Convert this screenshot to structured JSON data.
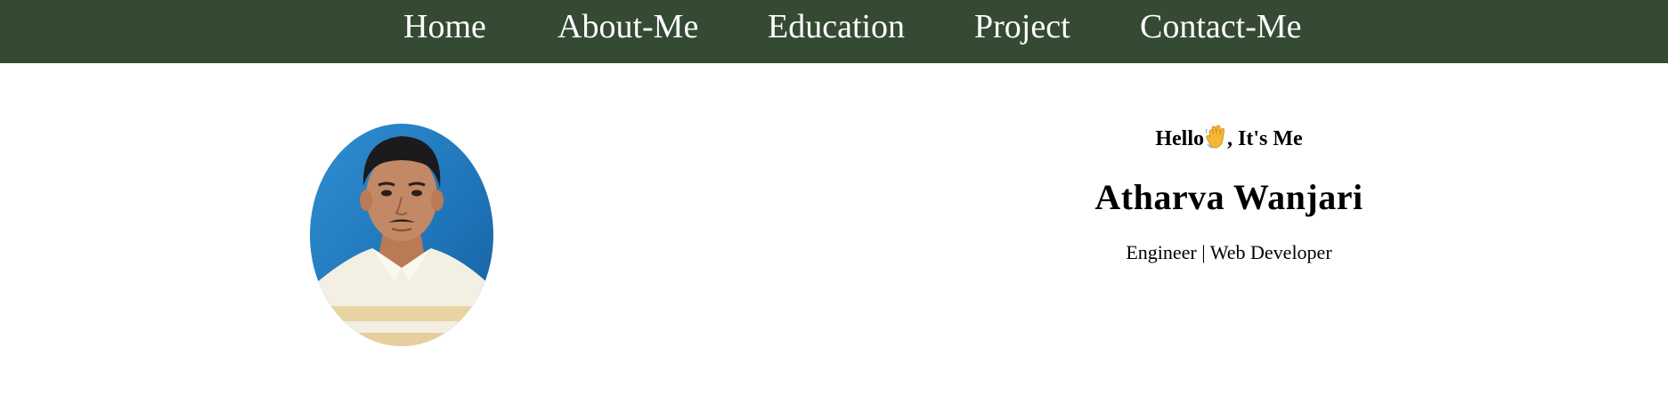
{
  "nav": {
    "items": [
      {
        "label": "Home"
      },
      {
        "label": "About-Me"
      },
      {
        "label": "Education"
      },
      {
        "label": "Project"
      },
      {
        "label": "Contact-Me"
      }
    ],
    "background": "#344a33",
    "text_color": "#ffffff"
  },
  "hero": {
    "greeting_before": "Hello",
    "greeting_icon": "waving-hand-icon",
    "greeting_after": ", It's Me",
    "name": "Atharva Wanjari",
    "tagline": "Engineer | Web Developer",
    "photo_icon": "profile-photo"
  }
}
